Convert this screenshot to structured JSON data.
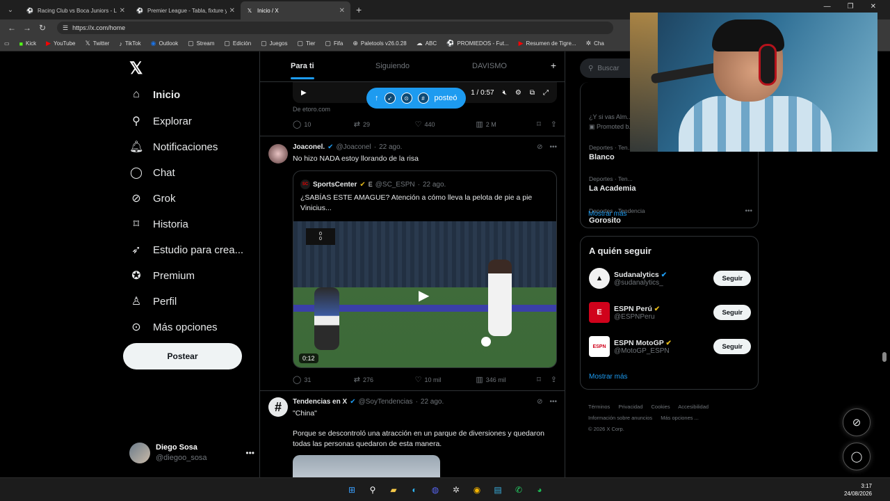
{
  "browser": {
    "tabs": [
      {
        "title": "Racing Club vs Boca Juniors - Liga",
        "favicon": "promiedos-icon"
      },
      {
        "title": "Premier League - Tabla, fixture y g",
        "favicon": "promiedos-icon"
      },
      {
        "title": "Inicio / X",
        "favicon": "x-icon",
        "active": true
      }
    ],
    "url": "https://x.com/home",
    "bookmarks": [
      "Kick",
      "YouTube",
      "Twitter",
      "TikTok",
      "Outlook",
      "Stream",
      "Edición",
      "Juegos",
      "Tier",
      "Fifa",
      "Paletools v26.0.28",
      "ABC",
      "PROMIEDOS - Fut...",
      "Resumen de Tigre...",
      "Cha"
    ]
  },
  "sidebar": {
    "items": [
      {
        "label": "Inicio",
        "icon": "home-icon"
      },
      {
        "label": "Explorar",
        "icon": "search-icon"
      },
      {
        "label": "Notificaciones",
        "icon": "bell-icon"
      },
      {
        "label": "Chat",
        "icon": "chat-icon"
      },
      {
        "label": "Grok",
        "icon": "grok-icon"
      },
      {
        "label": "Historia",
        "icon": "bookmark-icon"
      },
      {
        "label": "Estudio para crea...",
        "icon": "rocket-icon"
      },
      {
        "label": "Premium",
        "icon": "verified-icon"
      },
      {
        "label": "Perfil",
        "icon": "person-icon"
      },
      {
        "label": "Más opciones",
        "icon": "more-circle-icon"
      }
    ],
    "post_label": "Postear",
    "profile": {
      "name": "Diego Sosa",
      "handle": "@diegoo_sosa"
    }
  },
  "feed": {
    "tabs": [
      "Para ti",
      "Siguiendo",
      "DAVISMO"
    ],
    "video_time": "1 / 0:57",
    "posted_pill": "posteó",
    "ad_source": "De etoro.com",
    "ad_stats": {
      "replies": "10",
      "reposts": "29",
      "likes": "440",
      "views": "2 M"
    },
    "post1": {
      "name": "Joaconel.",
      "handle": "@Joaconel",
      "time": "22 ago.",
      "text": "No hizo NADA estoy llorando de la risa",
      "quote": {
        "name": "SportsCenter",
        "handle": "@SC_ESPN",
        "time": "22 ago.",
        "text": "¿SABÍAS ESTE AMAGUE? Atención a cómo lleva la pelota de pie a pie Vinicius...",
        "duration": "0:12"
      },
      "stats": {
        "replies": "31",
        "reposts": "276",
        "likes": "10 mil",
        "views": "346 mil"
      }
    },
    "post2": {
      "name": "Tendencias en X",
      "handle": "@SoyTendencias",
      "time": "22 ago.",
      "line1": "\"China\"",
      "line2": "Porque se descontroló una atracción en un parque de diversiones y quedaron todas las personas quedaron de esta manera."
    }
  },
  "right": {
    "search_placeholder": "Buscar",
    "promo_text": "¿Y si vas Alm...",
    "promoted": "Promoted b...",
    "trends": [
      {
        "category": "Deportes · Ten...",
        "name": "Blanco"
      },
      {
        "category": "Deportes · Ten...",
        "name": "La Academia"
      },
      {
        "category": "Deportes · Tendencia",
        "name": "Gorosito"
      }
    ],
    "show_more": "Mostrar más",
    "follow_title": "A quién seguir",
    "follow": [
      {
        "name": "Sudanalytics",
        "handle": "@sudanalytics_",
        "button": "Seguir"
      },
      {
        "name": "ESPN Perú",
        "handle": "@ESPNPeru",
        "button": "Seguir"
      },
      {
        "name": "ESPN MotoGP",
        "handle": "@MotoGP_ESPN",
        "button": "Seguir"
      }
    ],
    "follow_show_more": "Mostrar más",
    "footer": [
      "Términos",
      "Privacidad",
      "Cookies",
      "Accesibilidad",
      "Información sobre anuncios",
      "Más opciones ...",
      "© 2026 X Corp."
    ]
  },
  "taskbar": {
    "time": "3:17",
    "date": "24/08/2026"
  }
}
